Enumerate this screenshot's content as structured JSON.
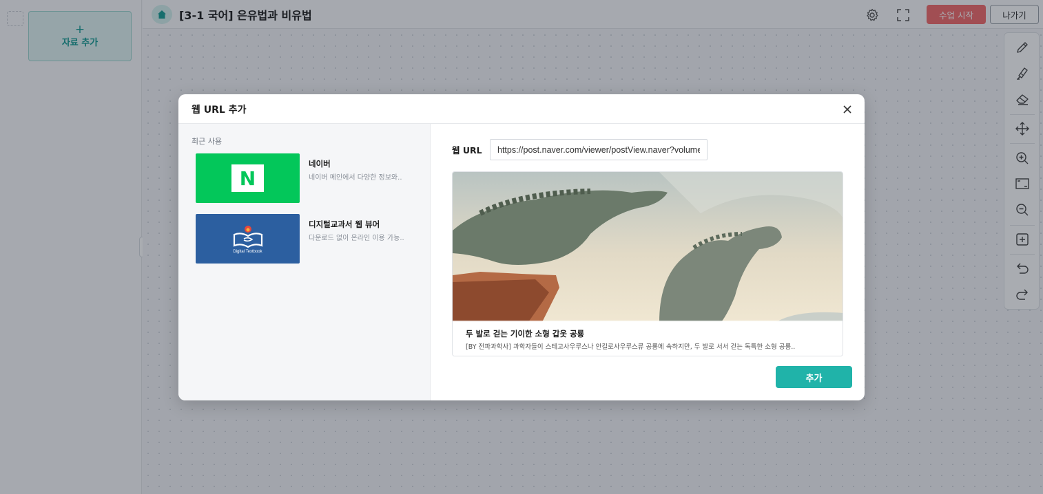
{
  "app": {
    "lesson_title": "[3-1 국어] 은유법과 비유법",
    "start_button": "수업 시작",
    "exit_button": "나가기",
    "add_material_plus": "+",
    "add_material_label": "자료 추가",
    "collapse_glyph": "‹"
  },
  "toolbar": {
    "tools": [
      "pencil-icon",
      "highlighter-icon",
      "eraser-icon",
      "move-icon",
      "zoom-in-icon",
      "fit-screen-icon",
      "zoom-out-icon",
      "add-page-icon",
      "undo-icon",
      "redo-icon"
    ]
  },
  "modal": {
    "title": "웹 URL 추가",
    "recent_label": "최근 사용",
    "recent": [
      {
        "name": "네이버",
        "desc": "네이버 메인에서 다양한 정보와..",
        "logo": "N"
      },
      {
        "name": "디지털교과서 웹 뷰어",
        "desc": "다운로드 없이 온라인 이용 가능..",
        "logo_caption": "Digital Textbook"
      }
    ],
    "url_label": "웹 URL",
    "url_value": "https://post.naver.com/viewer/postView.naver?volumeNo=",
    "preview": {
      "title": "두 발로 걷는 기이한 소형 갑옷 공룡",
      "desc": "[BY 전파과학사] 과학자들이 스테고사우루스나 안킬로사우루스류 공룡에 속하지만, 두 발로 서서 걷는 독특한 소형 공룡.."
    },
    "add_button": "추가"
  },
  "colors": {
    "accent": "#20b3a9",
    "start": "#f26d6d",
    "naver": "#03c75a",
    "textbook": "#2c5fa0"
  }
}
